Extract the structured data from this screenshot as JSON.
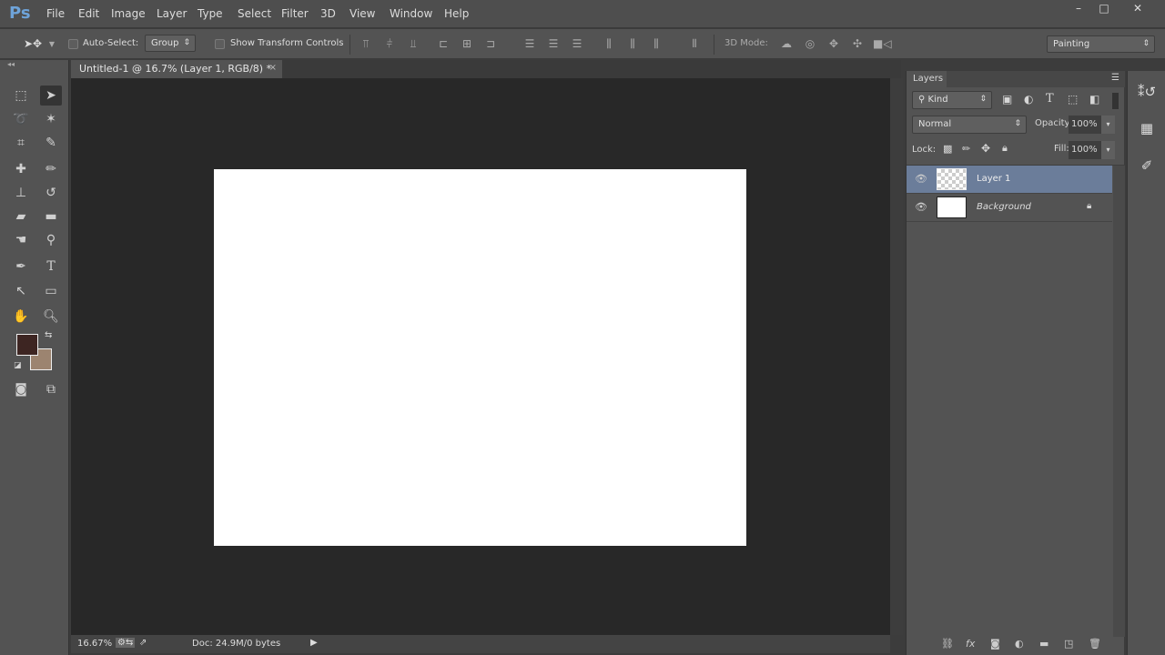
{
  "app": {
    "logo": "Ps"
  },
  "menu": [
    "File",
    "Edit",
    "Image",
    "Layer",
    "Type",
    "Select",
    "Filter",
    "3D",
    "View",
    "Window",
    "Help"
  ],
  "options": {
    "auto_select_label": "Auto-Select:",
    "auto_select_value": "Group",
    "show_transform_label": "Show Transform Controls",
    "mode3d_label": "3D Mode:",
    "workspace": "Painting"
  },
  "document": {
    "tab_title": "Untitled-1 @ 16.7% (Layer 1, RGB/8) *",
    "close": "×"
  },
  "status": {
    "zoom": "16.67%",
    "doc": "Doc: 24.9M/0 bytes"
  },
  "colors": {
    "foreground": "#3d2522",
    "background": "#9c8470",
    "canvas": "#ffffff",
    "selected_layer": "#6b7d9a"
  },
  "layers_panel": {
    "title": "Layers",
    "filter": "Kind",
    "blend_mode": "Normal",
    "opacity_label": "Opacity:",
    "opacity": "100%",
    "lock_label": "Lock:",
    "fill_label": "Fill:",
    "fill": "100%",
    "layers": [
      {
        "name": "Layer 1",
        "selected": true
      },
      {
        "name": "Background",
        "locked": true
      }
    ]
  }
}
